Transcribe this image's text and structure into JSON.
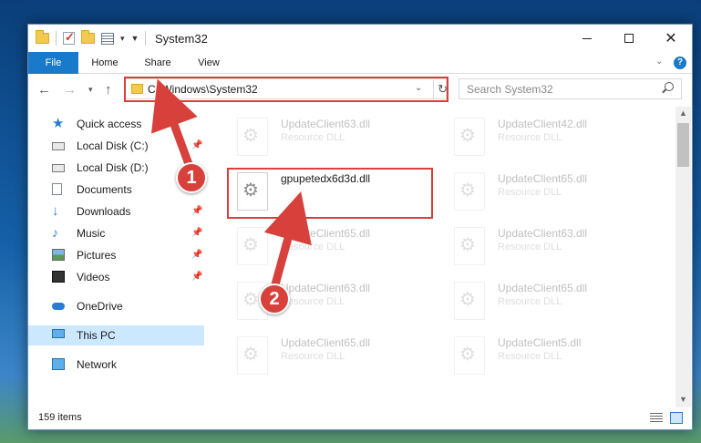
{
  "window": {
    "title": "System32"
  },
  "ribbon": {
    "tabs": [
      "File",
      "Home",
      "Share",
      "View"
    ]
  },
  "address_bar": {
    "path": "C:\\Windows\\System32"
  },
  "search": {
    "placeholder": "Search System32"
  },
  "nav_pane": {
    "items": [
      {
        "label": "Quick access",
        "icon": "star-icon",
        "pinned": false
      },
      {
        "label": "Local Disk (C:)",
        "icon": "drive-icon",
        "pinned": true
      },
      {
        "label": "Local Disk (D:)",
        "icon": "drive-icon",
        "pinned": false
      },
      {
        "label": "Documents",
        "icon": "documents-icon",
        "pinned": true
      },
      {
        "label": "Downloads",
        "icon": "download-icon",
        "pinned": true
      },
      {
        "label": "Music",
        "icon": "music-icon",
        "pinned": true
      },
      {
        "label": "Pictures",
        "icon": "pictures-icon",
        "pinned": true
      },
      {
        "label": "Videos",
        "icon": "videos-icon",
        "pinned": true
      },
      {
        "label": "OneDrive",
        "icon": "onedrive-icon",
        "pinned": false
      },
      {
        "label": "This PC",
        "icon": "this-pc-icon",
        "pinned": false,
        "selected": true
      },
      {
        "label": "Network",
        "icon": "network-icon",
        "pinned": false
      }
    ]
  },
  "files": {
    "left": [
      {
        "name": "UpdateClient63.dll",
        "type": "Resource DLL"
      },
      {
        "name": "gpupetedx6d3d.dll",
        "type": ""
      },
      {
        "name": "UpdateClient65.dll",
        "type": "Resource DLL"
      },
      {
        "name": "UpdateClient63.dll",
        "type": "Resource DLL"
      },
      {
        "name": "UpdateClient65.dll",
        "type": "Resource DLL"
      }
    ],
    "right": [
      {
        "name": "UpdateClient42.dll",
        "type": "Resource DLL"
      },
      {
        "name": "UpdateClient65.dll",
        "type": "Resource DLL"
      },
      {
        "name": "UpdateClient63.dll",
        "type": "Resource DLL"
      },
      {
        "name": "UpdateClient65.dll",
        "type": "Resource DLL"
      },
      {
        "name": "UpdateClient5.dll",
        "type": "Resource DLL"
      }
    ]
  },
  "status": {
    "item_count": "159 items"
  },
  "annotations": {
    "step_1": "1",
    "step_2": "2",
    "color": "#d8403c"
  }
}
